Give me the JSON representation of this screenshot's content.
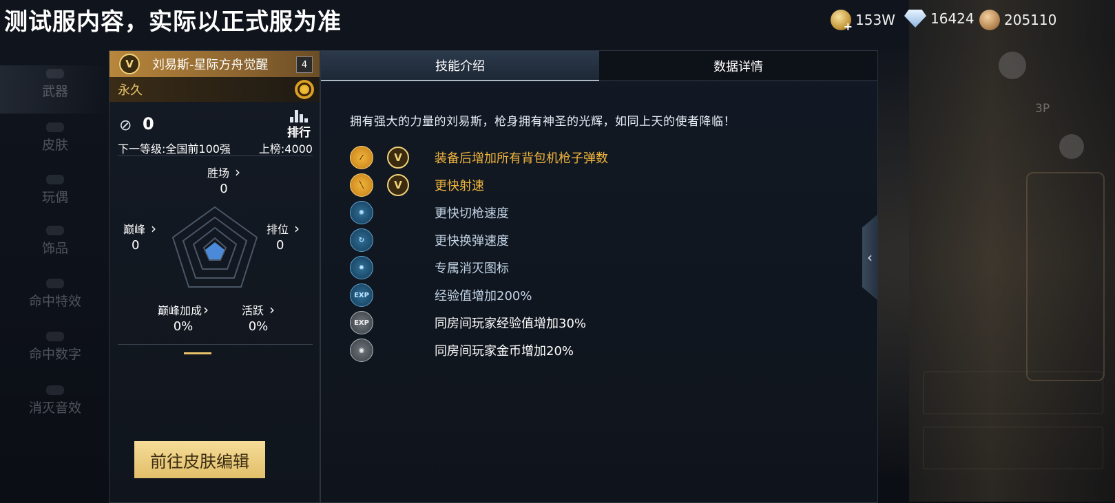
{
  "notice": "测试服内容，实际以正式服为准",
  "currencies": {
    "gold": "153W",
    "diamond": "16424",
    "bronze": "205110"
  },
  "right_bg": {
    "view_label": "3P"
  },
  "left_nav": [
    "武器",
    "皮肤",
    "玩偶",
    "饰品",
    "命中特效",
    "命中数字",
    "消灭音效"
  ],
  "card": {
    "title": "刘易斯-星际方舟觉醒",
    "badge": "V",
    "level": "4",
    "duration": "永久",
    "kills": "0",
    "rank_label": "排行",
    "next_level": "下一等级:全国前100强",
    "listed": "上榜:4000",
    "stats": {
      "wins": {
        "label": "胜场",
        "value": "0"
      },
      "peak": {
        "label": "巅峰",
        "value": "0"
      },
      "rank": {
        "label": "排位",
        "value": "0"
      },
      "peak_bonus": {
        "label": "巅峰加成",
        "value": "0%"
      },
      "active": {
        "label": "活跃",
        "value": "0%"
      }
    },
    "edit_button": "前往皮肤编辑"
  },
  "panel": {
    "tabs": [
      "技能介绍",
      "数据详情"
    ],
    "active_tab": 0,
    "description": "拥有强大的力量的刘易斯，枪身拥有神圣的光辉，如同上天的使者降临！",
    "skills": [
      {
        "text": "装备后增加所有背包机枪子弹数",
        "icon": "ammo-icon",
        "vip": true
      },
      {
        "text": "更快射速",
        "icon": "bullet-icon",
        "vip": true
      },
      {
        "text": "更快切枪速度",
        "icon": "switch-gun-icon",
        "vip": false
      },
      {
        "text": "更快换弹速度",
        "icon": "reload-icon",
        "vip": false
      },
      {
        "text": "专属消灭图标",
        "icon": "kill-mark-icon",
        "vip": false
      },
      {
        "text": "经验值增加200%",
        "icon": "exp-icon",
        "vip": false,
        "icon_text": "EXP"
      },
      {
        "text": "同房间玩家经验值增加30%",
        "icon": "room-exp-icon",
        "vip": false,
        "icon_text": "EXP"
      },
      {
        "text": "同房间玩家金币增加20%",
        "icon": "room-coin-icon",
        "vip": false
      }
    ]
  },
  "colors": {
    "accent_gold": "#f0b43c",
    "button_gold": "#e8c87a"
  }
}
